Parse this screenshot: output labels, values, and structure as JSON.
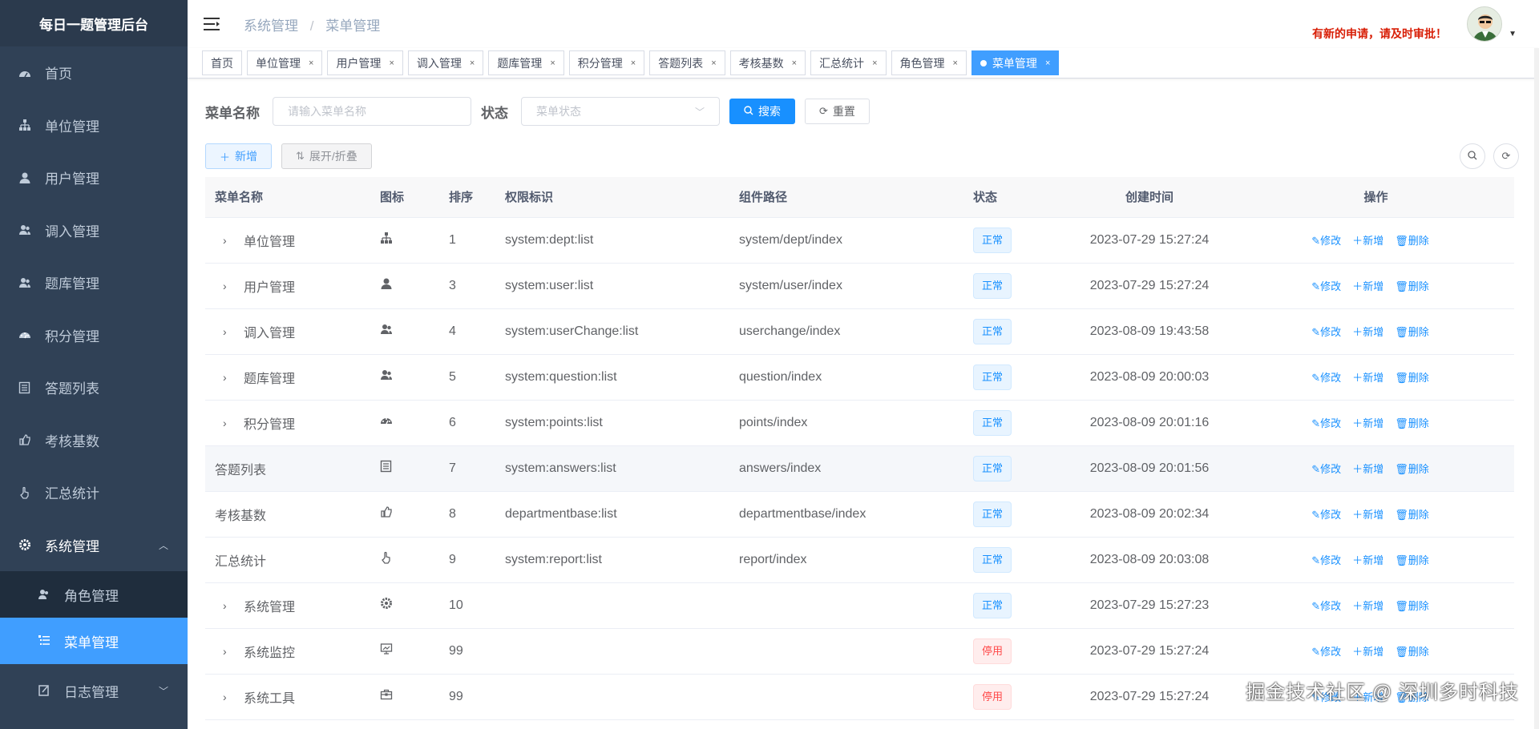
{
  "app": {
    "title": "每日一题管理后台"
  },
  "sidebar": {
    "items": [
      {
        "label": "首页",
        "icon": "dashboard-icon"
      },
      {
        "label": "单位管理",
        "icon": "tree-icon"
      },
      {
        "label": "用户管理",
        "icon": "user-icon"
      },
      {
        "label": "调入管理",
        "icon": "peoples-icon"
      },
      {
        "label": "题库管理",
        "icon": "peoples-icon"
      },
      {
        "label": "积分管理",
        "icon": "gauge-icon"
      },
      {
        "label": "答题列表",
        "icon": "list-icon"
      },
      {
        "label": "考核基数",
        "icon": "thumb-icon"
      },
      {
        "label": "汇总统计",
        "icon": "hand-icon"
      }
    ],
    "system": {
      "label": "系统管理",
      "icon": "gear-icon"
    },
    "sub_items": [
      {
        "label": "角色管理",
        "icon": "peoples-icon"
      },
      {
        "label": "菜单管理",
        "icon": "tree-table-icon"
      },
      {
        "label": "日志管理",
        "icon": "log-icon"
      }
    ]
  },
  "navbar": {
    "breadcrumb": [
      "系统管理",
      "菜单管理"
    ],
    "notice": "有新的申请，请及时审批！"
  },
  "tags": [
    "首页",
    "单位管理",
    "用户管理",
    "调入管理",
    "题库管理",
    "积分管理",
    "答题列表",
    "考核基数",
    "汇总统计",
    "角色管理",
    "菜单管理"
  ],
  "active_tag": "菜单管理",
  "search": {
    "name_label": "菜单名称",
    "name_placeholder": "请输入菜单名称",
    "status_label": "状态",
    "status_placeholder": "菜单状态",
    "search_btn": "搜索",
    "reset_btn": "重置"
  },
  "toolbar": {
    "add_btn": "新增",
    "expand_btn": "展开/折叠"
  },
  "table": {
    "headers": [
      "菜单名称",
      "图标",
      "排序",
      "权限标识",
      "组件路径",
      "状态",
      "创建时间",
      "操作"
    ],
    "ops": [
      "修改",
      "新增",
      "删除"
    ],
    "rows": [
      {
        "name": "单位管理",
        "expandable": true,
        "icon": "tree-icon",
        "order": "1",
        "perm": "system:dept:list",
        "path": "system/dept/index",
        "status": "正常",
        "status_type": "ok",
        "time": "2023-07-29 15:27:24"
      },
      {
        "name": "用户管理",
        "expandable": true,
        "icon": "user-icon",
        "order": "3",
        "perm": "system:user:list",
        "path": "system/user/index",
        "status": "正常",
        "status_type": "ok",
        "time": "2023-07-29 15:27:24"
      },
      {
        "name": "调入管理",
        "expandable": true,
        "icon": "peoples-icon",
        "order": "4",
        "perm": "system:userChange:list",
        "path": "userchange/index",
        "status": "正常",
        "status_type": "ok",
        "time": "2023-08-09 19:43:58"
      },
      {
        "name": "题库管理",
        "expandable": true,
        "icon": "peoples-icon",
        "order": "5",
        "perm": "system:question:list",
        "path": "question/index",
        "status": "正常",
        "status_type": "ok",
        "time": "2023-08-09 20:00:03"
      },
      {
        "name": "积分管理",
        "expandable": true,
        "icon": "gauge-icon",
        "order": "6",
        "perm": "system:points:list",
        "path": "points/index",
        "status": "正常",
        "status_type": "ok",
        "time": "2023-08-09 20:01:16"
      },
      {
        "name": "答题列表",
        "expandable": false,
        "icon": "list-icon",
        "order": "7",
        "perm": "system:answers:list",
        "path": "answers/index",
        "status": "正常",
        "status_type": "ok",
        "time": "2023-08-09 20:01:56"
      },
      {
        "name": "考核基数",
        "expandable": false,
        "icon": "thumb-icon",
        "order": "8",
        "perm": "departmentbase:list",
        "path": "departmentbase/index",
        "status": "正常",
        "status_type": "ok",
        "time": "2023-08-09 20:02:34"
      },
      {
        "name": "汇总统计",
        "expandable": false,
        "icon": "hand-icon",
        "order": "9",
        "perm": "system:report:list",
        "path": "report/index",
        "status": "正常",
        "status_type": "ok",
        "time": "2023-08-09 20:03:08"
      },
      {
        "name": "系统管理",
        "expandable": true,
        "icon": "gear-icon",
        "order": "10",
        "perm": "",
        "path": "",
        "status": "正常",
        "status_type": "ok",
        "time": "2023-07-29 15:27:23"
      },
      {
        "name": "系统监控",
        "expandable": true,
        "icon": "monitor-icon",
        "order": "99",
        "perm": "",
        "path": "",
        "status": "停用",
        "status_type": "off",
        "time": "2023-07-29 15:27:24"
      },
      {
        "name": "系统工具",
        "expandable": true,
        "icon": "toolbox-icon",
        "order": "99",
        "perm": "",
        "path": "",
        "status": "停用",
        "status_type": "off",
        "time": "2023-07-29 15:27:24"
      }
    ]
  },
  "watermark": "掘金技术社区 @ 深圳多时科技",
  "colors": {
    "sidebar_bg": "#304156",
    "primary": "#1890ff",
    "danger": "#ff4949",
    "notice": "#d81e06"
  }
}
